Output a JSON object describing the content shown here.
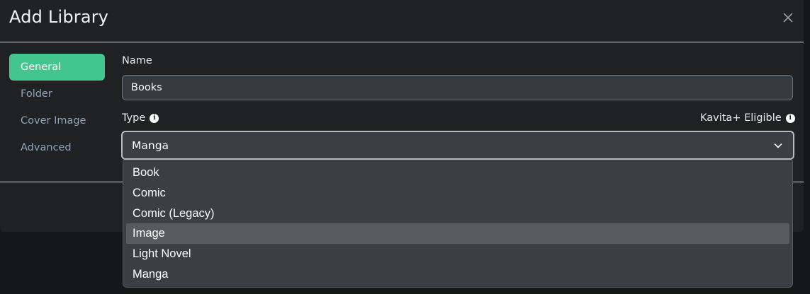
{
  "modal": {
    "title": "Add Library"
  },
  "nav": {
    "items": [
      {
        "label": "General",
        "active": true
      },
      {
        "label": "Folder",
        "active": false
      },
      {
        "label": "Cover Image",
        "active": false
      },
      {
        "label": "Advanced",
        "active": false
      }
    ]
  },
  "form": {
    "name_label": "Name",
    "name_value": "Books",
    "type_label": "Type",
    "kavita_label": "Kavita+ Eligible",
    "type_selected": "Manga",
    "type_options": [
      "Book",
      "Comic",
      "Comic (Legacy)",
      "Image",
      "Light Novel",
      "Manga"
    ],
    "highlighted_option": "Image"
  },
  "icons": {
    "close": "close-icon",
    "info": "info-icon",
    "chevron": "chevron-down-icon"
  },
  "colors": {
    "accent": "#43c590",
    "modal_bg": "#202123",
    "dropdown_bg": "#3b3f43"
  }
}
